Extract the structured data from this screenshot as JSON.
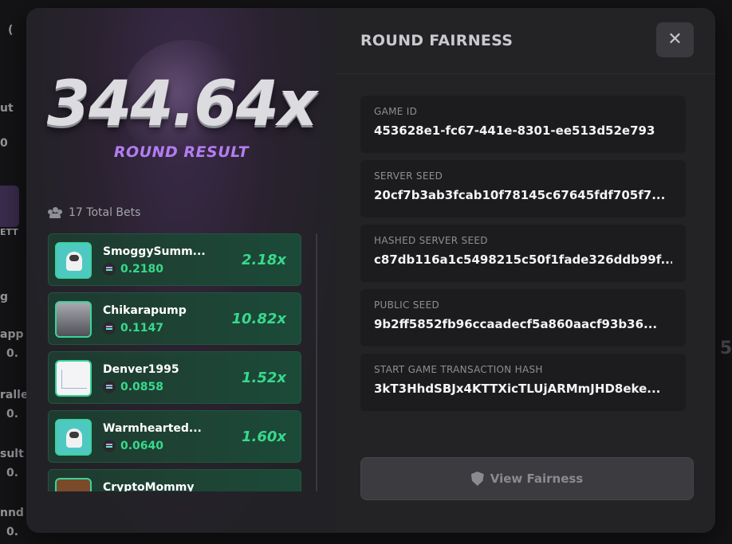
{
  "background": {
    "left_fragments": [
      "(",
      "ut",
      "0",
      "ETT",
      "g",
      "app",
      "0.",
      "ralle",
      "0.",
      "sult",
      "0.",
      "nnd",
      "0."
    ],
    "right_fragment": "5"
  },
  "round": {
    "multiplier": "344.64x",
    "result_label": "ROUND RESULT"
  },
  "bets": {
    "total_label": "17 Total Bets",
    "rows": [
      {
        "name": "SmoggySumm...",
        "amount": "0.2180",
        "multiplier": "2.18x",
        "avatar": "astronaut"
      },
      {
        "name": "Chikarapump",
        "amount": "0.1147",
        "multiplier": "10.82x",
        "avatar": "city"
      },
      {
        "name": "Denver1995",
        "amount": "0.0858",
        "multiplier": "1.52x",
        "avatar": "chart"
      },
      {
        "name": "Warmhearted...",
        "amount": "0.0640",
        "multiplier": "1.60x",
        "avatar": "astronaut"
      },
      {
        "name": "CryptoMommy",
        "amount": "",
        "multiplier": "",
        "avatar": "cm"
      }
    ]
  },
  "fairness": {
    "title": "ROUND FAIRNESS",
    "close_icon": "close-icon",
    "fields": [
      {
        "label": "GAME ID",
        "value": "453628e1-fc67-441e-8301-ee513d52e793"
      },
      {
        "label": "SERVER SEED",
        "value": "20cf7b3ab3fcab10f78145c67645fdf705f7..."
      },
      {
        "label": "HASHED SERVER SEED",
        "value": "c87db116a1c5498215c50f1fade326ddb99f..."
      },
      {
        "label": "PUBLIC SEED",
        "value": "9b2ff5852fb96ccaadecf5a860aacf93b36..."
      },
      {
        "label": "START GAME TRANSACTION HASH",
        "value": "3kT3HhdSBJx4KTTXicTLUjARMmJHD8eke..."
      }
    ],
    "view_button": "View Fairness"
  },
  "colors": {
    "accent_purple": "#b37df0",
    "win_green": "#38d98d",
    "panel": "#232326"
  }
}
